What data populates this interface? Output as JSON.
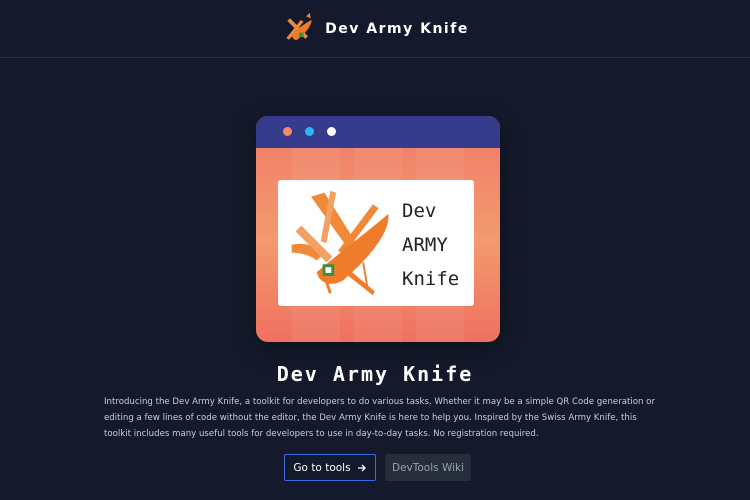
{
  "header": {
    "brand_name": "Dev Army Knife",
    "logo_icon": "swiss-army-knife-icon"
  },
  "hero": {
    "window_dots": [
      "#f2896c",
      "#2cb6f2",
      "#ffffff"
    ],
    "card_lines": [
      "Dev",
      "ARMY",
      "Knife"
    ],
    "card_icon": "swiss-army-knife-icon"
  },
  "main": {
    "title": "Dev Army Knife",
    "description": "Introducing the Dev Army Knife, a toolkit for developers to do various tasks. Whether it may be a simple QR Code generation or editing a few lines of code without the editor, the Dev Army Knife is here to help you. Inspired by the Swiss Army Knife, this toolkit includes many useful tools for developers to use in day-to-day tasks. No registration required.",
    "primary_button": "Go to tools",
    "primary_button_icon": "arrow-right-icon",
    "secondary_button": "DevTools Wiki"
  },
  "colors": {
    "background": "#141a2b",
    "accent": "#3d6ae3",
    "window_bar": "#363c8b",
    "window_gradient": [
      "#f07a68",
      "#f39a6e"
    ],
    "knife_orange": "#f08a3a"
  }
}
